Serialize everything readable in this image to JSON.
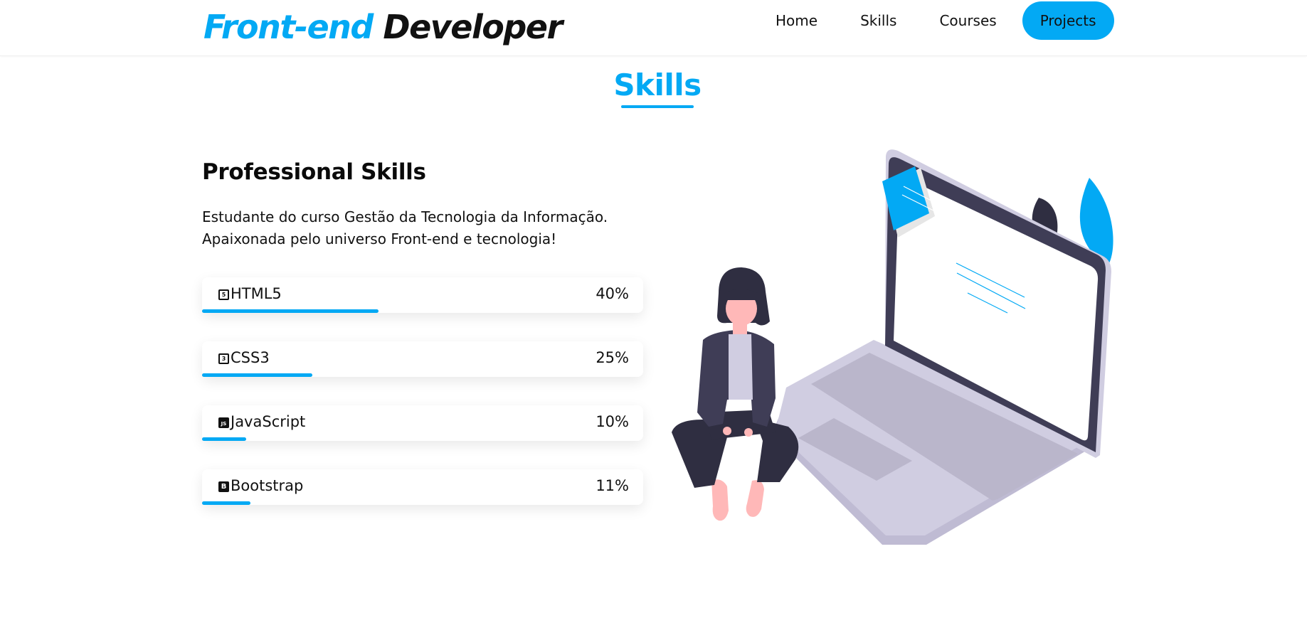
{
  "header": {
    "logo_accent": "Front-end",
    "logo_rest": "Developer",
    "nav": [
      {
        "label": "Home",
        "active": false
      },
      {
        "label": "Skills",
        "active": false
      },
      {
        "label": "Courses",
        "active": false
      },
      {
        "label": "Projects",
        "active": true
      }
    ]
  },
  "section": {
    "title": "Skills"
  },
  "left": {
    "heading": "Professional Skills",
    "intro_lines": [
      "Estudante do curso Gestão da Tecnologia da Informação.",
      "Apaixonada pelo universo Front-end e tecnologia!"
    ]
  },
  "skills": [
    {
      "name": "HTML5",
      "percent_label": "40%",
      "level": 40,
      "icon": "html5-icon",
      "glyph": "5"
    },
    {
      "name": "CSS3",
      "percent_label": "25%",
      "level": 25,
      "icon": "css3-icon",
      "glyph": "3"
    },
    {
      "name": "JavaScript",
      "percent_label": "10%",
      "level": 10,
      "icon": "javascript-icon",
      "glyph": "JS"
    },
    {
      "name": "Bootstrap",
      "percent_label": "11%",
      "level": 11,
      "icon": "bootstrap-icon",
      "glyph": "B"
    }
  ],
  "colors": {
    "accent": "#03a9f4",
    "text": "#111111",
    "laptop_body": "#d0cde1",
    "laptop_dark": "#3f3d56"
  }
}
